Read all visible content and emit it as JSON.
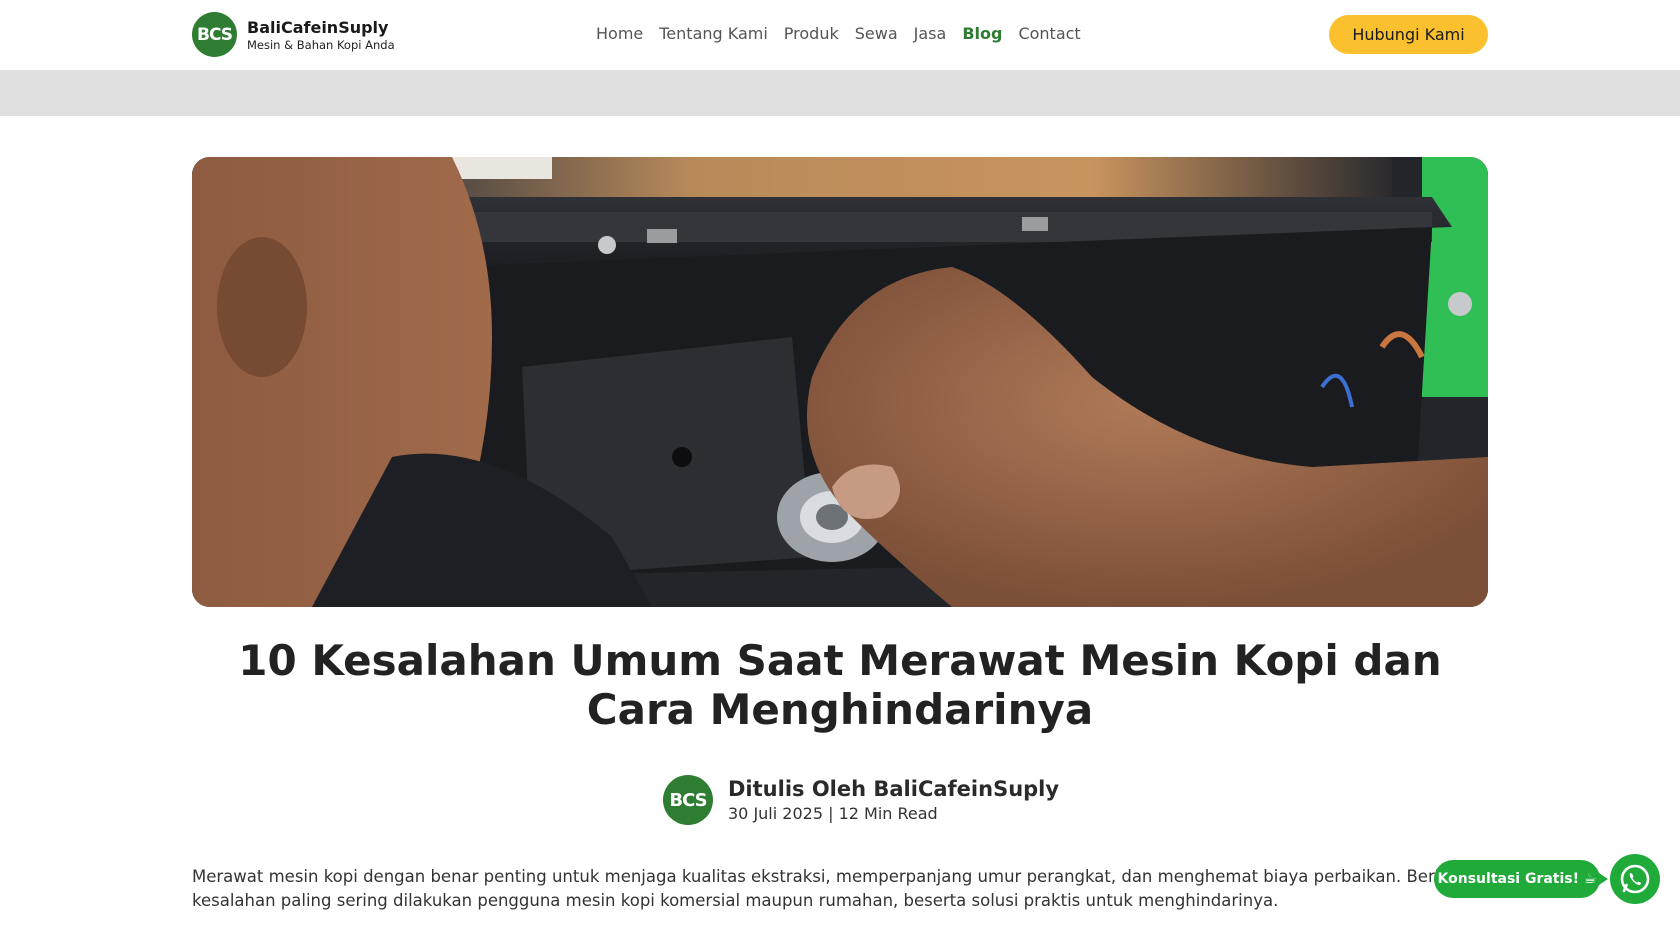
{
  "brand": {
    "badge": "BCS",
    "name": "BaliCafeinSuply",
    "tagline": "Mesin & Bahan Kopi Anda",
    "color": "#2e7d32"
  },
  "nav": {
    "items": [
      {
        "label": "Home"
      },
      {
        "label": "Tentang Kami"
      },
      {
        "label": "Produk"
      },
      {
        "label": "Sewa"
      },
      {
        "label": "Jasa"
      },
      {
        "label": "Blog",
        "active": true
      },
      {
        "label": "Contact"
      }
    ]
  },
  "header": {
    "cta_label": "Hubungi Kami",
    "cta_color": "#fbc02d"
  },
  "article": {
    "title": "10 Kesalahan Umum Saat Merawat Mesin Kopi dan Cara Menghindarinya",
    "author_badge": "BCS",
    "author": "Ditulis Oleh BaliCafeinSuply",
    "meta": "30 Juli 2025 | 12 Min Read",
    "intro": "Merawat mesin kopi dengan benar penting untuk menjaga kualitas ekstraksi, memperpanjang umur perangkat, dan menghemat biaya perbaikan. Berikut kesalahan paling sering dilakukan pengguna mesin kopi komersial maupun rumahan, beserta solusi praktis untuk menghindarinya."
  },
  "whatsapp": {
    "label": "Konsultasi Gratis! ☕",
    "icon": "whatsapp-icon",
    "color": "#1faa3a"
  }
}
